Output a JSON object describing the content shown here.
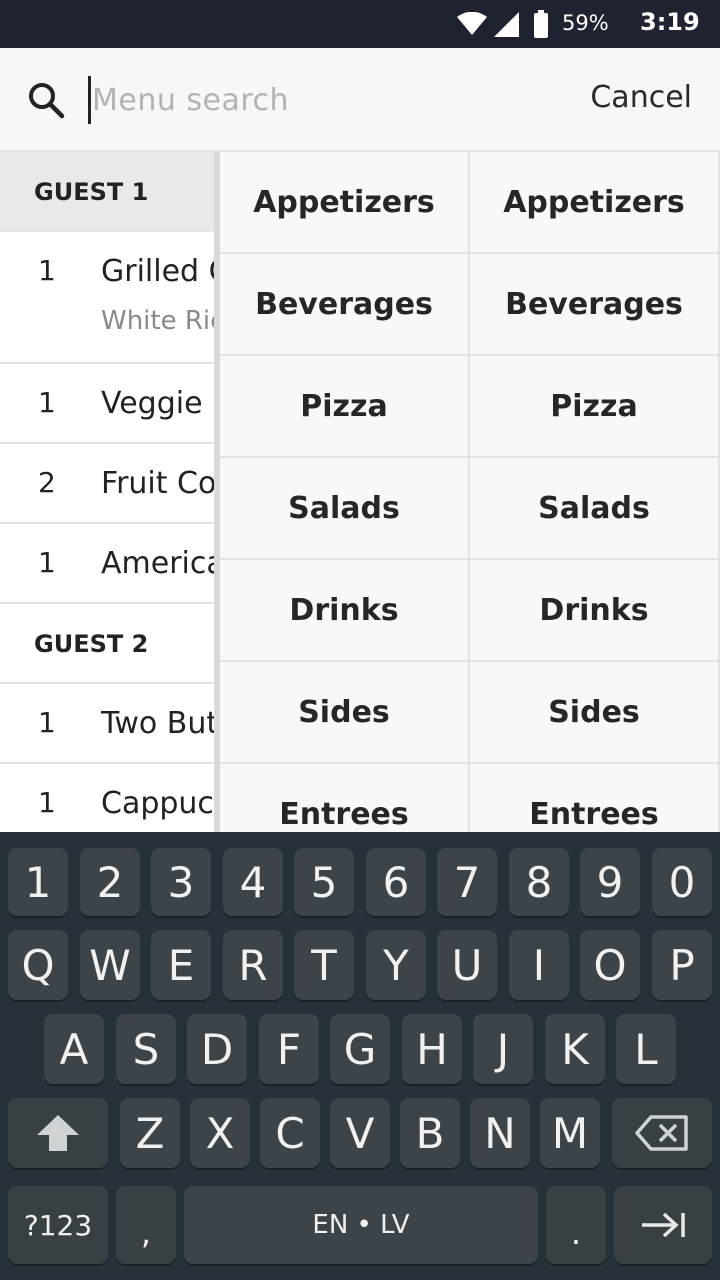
{
  "status": {
    "battery_pct": "59%",
    "time": "3:19"
  },
  "search": {
    "placeholder": "Menu search",
    "value": "",
    "cancel_label": "Cancel"
  },
  "order": {
    "guests": [
      {
        "label": "GUEST 1",
        "items": [
          {
            "qty": "1",
            "name": "Grilled Cheese",
            "modifier": "White Rice"
          },
          {
            "qty": "1",
            "name": "Veggie Burger"
          },
          {
            "qty": "2",
            "name": "Fruit Cocktail"
          },
          {
            "qty": "1",
            "name": "Americano"
          }
        ]
      },
      {
        "label": "GUEST 2",
        "items": [
          {
            "qty": "1",
            "name": "Two Butter"
          },
          {
            "qty": "1",
            "name": "Cappuccino"
          }
        ]
      }
    ]
  },
  "categories": [
    "Appetizers",
    "Appetizers",
    "Beverages",
    "Beverages",
    "Pizza",
    "Pizza",
    "Salads",
    "Salads",
    "Drinks",
    "Drinks",
    "Sides",
    "Sides",
    "Entrees",
    "Entrees"
  ],
  "keyboard": {
    "row1": [
      "1",
      "2",
      "3",
      "4",
      "5",
      "6",
      "7",
      "8",
      "9",
      "0"
    ],
    "row2": [
      "Q",
      "W",
      "E",
      "R",
      "T",
      "Y",
      "U",
      "I",
      "O",
      "P"
    ],
    "row3": [
      "A",
      "S",
      "D",
      "F",
      "G",
      "H",
      "J",
      "K",
      "L"
    ],
    "row4": [
      "Z",
      "X",
      "C",
      "V",
      "B",
      "N",
      "M"
    ],
    "symbols_label": "?123",
    "comma": ",",
    "space_label": "EN • LV",
    "period": "."
  }
}
